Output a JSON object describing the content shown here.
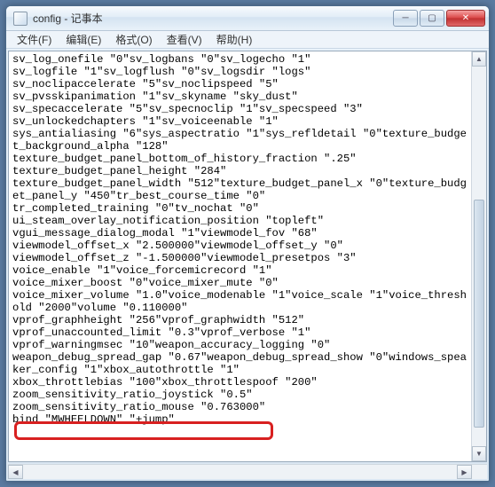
{
  "window": {
    "title": "config - 记事本"
  },
  "menu": {
    "file": "文件(F)",
    "edit": "编辑(E)",
    "format": "格式(O)",
    "view": "查看(V)",
    "help": "帮助(H)"
  },
  "controls": {
    "minimize": "─",
    "maximize": "▢",
    "close": "✕"
  },
  "scroll": {
    "up": "▲",
    "down": "▼",
    "left": "◀",
    "right": "▶"
  },
  "content": "sv_log_onefile \"0\"sv_logbans \"0\"sv_logecho \"1\"\nsv_logfile \"1\"sv_logflush \"0\"sv_logsdir \"logs\"\nsv_noclipaccelerate \"5\"sv_noclipspeed \"5\"\nsv_pvsskipanimation \"1\"sv_skyname \"sky_dust\"\nsv_specaccelerate \"5\"sv_specnoclip \"1\"sv_specspeed \"3\"\nsv_unlockedchapters \"1\"sv_voiceenable \"1\"\nsys_antialiasing \"6\"sys_aspectratio \"1\"sys_refldetail \"0\"texture_budget_background_alpha \"128\"\ntexture_budget_panel_bottom_of_history_fraction \".25\"\ntexture_budget_panel_height \"284\"\ntexture_budget_panel_width \"512\"texture_budget_panel_x \"0\"texture_budget_panel_y \"450\"tr_best_course_time \"0\"\ntr_completed_training \"0\"tv_nochat \"0\"\nui_steam_overlay_notification_position \"topleft\"\nvgui_message_dialog_modal \"1\"viewmodel_fov \"68\"\nviewmodel_offset_x \"2.500000\"viewmodel_offset_y \"0\"\nviewmodel_offset_z \"-1.500000\"viewmodel_presetpos \"3\"\nvoice_enable \"1\"voice_forcemicrecord \"1\"\nvoice_mixer_boost \"0\"voice_mixer_mute \"0\"\nvoice_mixer_volume \"1.0\"voice_modenable \"1\"voice_scale \"1\"voice_threshold \"2000\"volume \"0.110000\"\nvprof_graphheight \"256\"vprof_graphwidth \"512\"\nvprof_unaccounted_limit \"0.3\"vprof_verbose \"1\"\nvprof_warningmsec \"10\"weapon_accuracy_logging \"0\"\nweapon_debug_spread_gap \"0.67\"weapon_debug_spread_show \"0\"windows_speaker_config \"1\"xbox_autothrottle \"1\"\nxbox_throttlebias \"100\"xbox_throttlespoof \"200\"\nzoom_sensitivity_ratio_joystick \"0.5\"\nzoom_sensitivity_ratio_mouse \"0.763000\"\nbind \"MWHEELDOWN\" \"+jump\""
}
